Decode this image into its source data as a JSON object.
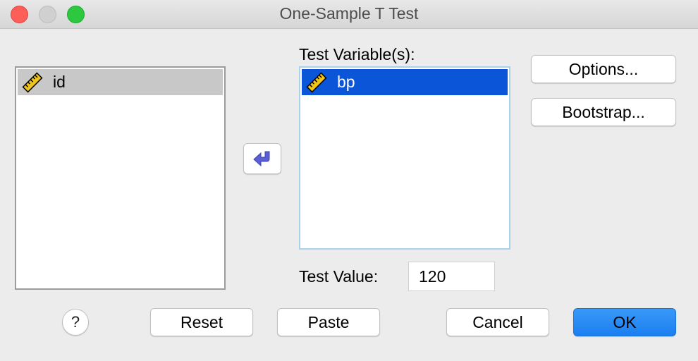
{
  "window": {
    "title": "One-Sample T Test"
  },
  "source_list": {
    "items": [
      {
        "label": "id",
        "icon": "ruler-icon",
        "selected": true
      }
    ]
  },
  "target_list": {
    "label": "Test Variable(s):",
    "items": [
      {
        "label": "bp",
        "icon": "ruler-icon",
        "selected": true
      }
    ]
  },
  "side_buttons": {
    "options": "Options...",
    "bootstrap": "Bootstrap..."
  },
  "test_value": {
    "label": "Test Value:",
    "value": "120"
  },
  "footer": {
    "help": "?",
    "reset": "Reset",
    "paste": "Paste",
    "cancel": "Cancel",
    "ok": "OK"
  },
  "colors": {
    "selection_blue": "#0a55d8",
    "ok_blue": "#1a7ff1",
    "close_red": "#fc5f57",
    "max_green": "#2dc840"
  }
}
